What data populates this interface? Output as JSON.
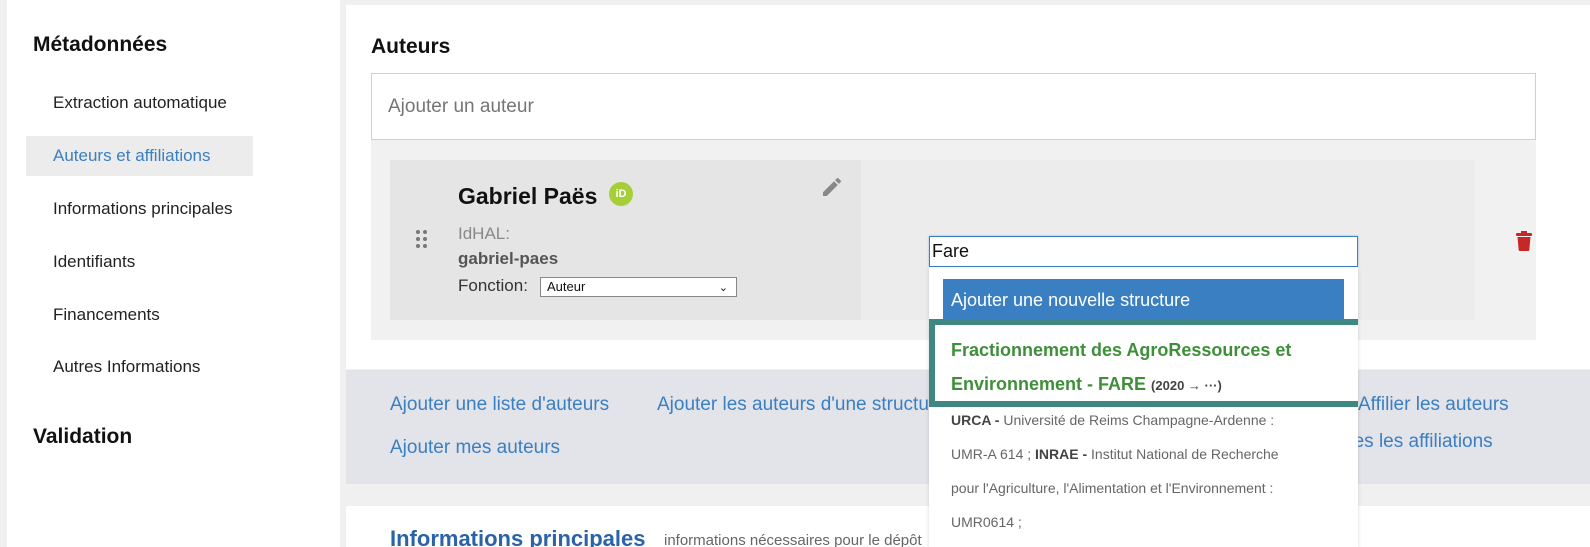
{
  "sidebar": {
    "heading_metadata": "Métadonnées",
    "items": [
      {
        "label": "Extraction automatique",
        "active": false
      },
      {
        "label": "Auteurs et affiliations",
        "active": true
      },
      {
        "label": "Informations principales",
        "active": false
      },
      {
        "label": "Identifiants",
        "active": false
      },
      {
        "label": "Financements",
        "active": false
      },
      {
        "label": "Autres Informations",
        "active": false
      }
    ],
    "heading_validation": "Validation"
  },
  "authors": {
    "title": "Auteurs",
    "add_placeholder": "Ajouter un auteur",
    "author": {
      "name": "Gabriel Paës",
      "orcid_label": "iD",
      "idhal_label": "IdHAL:",
      "idhal_value": "gabriel-paes",
      "fonction_label": "Fonction:",
      "fonction_value": "Auteur"
    }
  },
  "structure_search": {
    "value": "Fare",
    "add_new": "Ajouter une nouvelle structure",
    "highlight_name": "Fractionnement des AgroRessources et Environnement - FARE",
    "highlight_date": "(2020 → ···)",
    "detail_line1_bold": "URCA -",
    "detail_line1": " Université de Reims Champagne-Ardenne :",
    "detail_line2_a": "UMR-A 614 ; ",
    "detail_line2_bold": "INRAE -",
    "detail_line2_b": " Institut National de Recherche",
    "detail_line3": "pour l'Agriculture, l'Alimentation et l'Environnement :",
    "detail_line4": "UMR0614 ;"
  },
  "actions": {
    "add_list": "Ajouter une liste d'auteurs",
    "add_from_structure": "Ajouter les auteurs d'une structure",
    "add_mine": "Ajouter mes auteurs",
    "affiliate": "Affilier les auteurs",
    "all_affiliations": "Supprimer toutes les affiliations"
  },
  "bottom_section": {
    "title": "Informations principales",
    "subtitle": "informations nécessaires pour le dépôt"
  },
  "colors": {
    "accent": "#3a7fc1",
    "highlight_border": "#3f8782",
    "highlight_text": "#3f8f3a",
    "orcid": "#a6ce39",
    "delete": "#c62828"
  }
}
